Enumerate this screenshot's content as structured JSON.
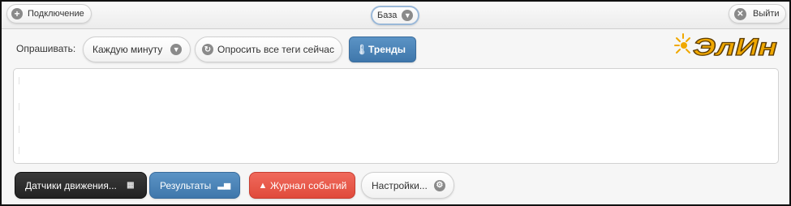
{
  "topbar": {
    "connect_label": "Подключение",
    "base_label": "База",
    "exit_label": "Выйти"
  },
  "toolbar": {
    "poll_label": "Опрашивать:",
    "interval_value": "Каждую минуту",
    "poll_all_label": "Опросить все теги сейчас",
    "trends_label": "Тренды"
  },
  "logo": {
    "text": "ЭлИн",
    "colors": {
      "letters": "#f0a800",
      "outline": "#5a3a00"
    }
  },
  "bottom_buttons": {
    "sensors_label": "Датчики движения...",
    "results_label": "Результаты",
    "events_label": "Журнал событий",
    "settings_label": "Настройки..."
  },
  "colors": {
    "blue": "#4a84ba",
    "dark": "#2b2b2b",
    "red": "#e8554a",
    "base_border": "#9ab8d8"
  },
  "icons": {
    "connect": "plus-circle-icon",
    "base": "chevron-down-icon",
    "exit": "close-circle-icon",
    "interval": "chevron-down-icon",
    "poll_all": "refresh-icon",
    "trends": "thermometer-icon",
    "sensors": "grid-icon",
    "results": "bar-chart-icon",
    "events": "warning-icon",
    "settings": "gear-icon"
  }
}
